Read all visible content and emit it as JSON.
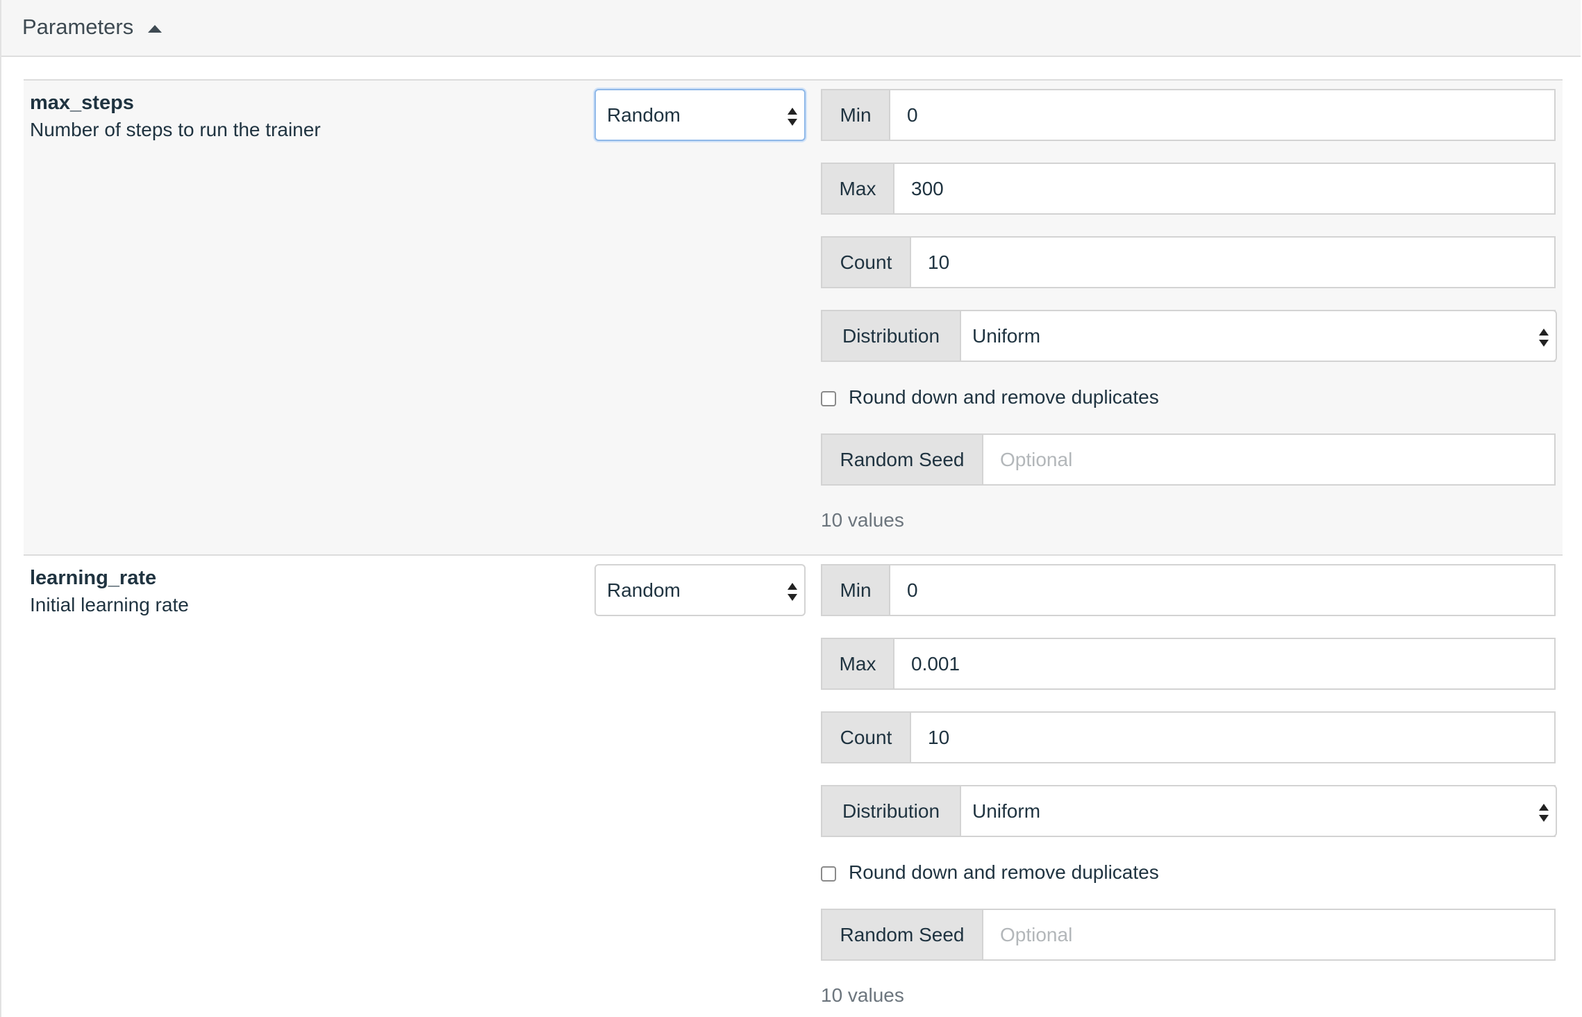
{
  "panel": {
    "title": "Parameters",
    "collapse_icon": "caret-up-icon"
  },
  "parameters": [
    {
      "name": "max_steps",
      "description": "Number of steps to run the trainer",
      "mode": "Random",
      "min_label": "Min",
      "min_value": "0",
      "max_label": "Max",
      "max_value": "300",
      "count_label": "Count",
      "count_value": "10",
      "distribution_label": "Distribution",
      "distribution_value": "Uniform",
      "round_label": "Round down and remove duplicates",
      "round_checked": false,
      "seed_label": "Random Seed",
      "seed_placeholder": "Optional",
      "values_summary": "10 values"
    },
    {
      "name": "learning_rate",
      "description": "Initial learning rate",
      "mode": "Random",
      "min_label": "Min",
      "min_value": "0",
      "max_label": "Max",
      "max_value": "0.001",
      "count_label": "Count",
      "count_value": "10",
      "distribution_label": "Distribution",
      "distribution_value": "Uniform",
      "round_label": "Round down and remove duplicates",
      "round_checked": false,
      "seed_label": "Random Seed",
      "seed_placeholder": "Optional",
      "values_summary": "10 values"
    }
  ]
}
